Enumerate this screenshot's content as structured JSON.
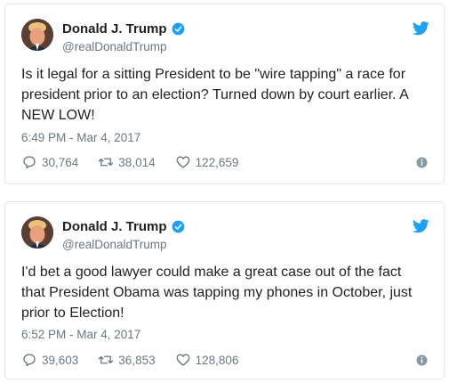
{
  "tweets": [
    {
      "name": "Donald J. Trump",
      "handle": "@realDonaldTrump",
      "text": "Is it legal for a sitting President to be \"wire tapping\" a race for president prior to an election? Turned down by court earlier. A NEW LOW!",
      "timestamp": "6:49 PM - Mar 4, 2017",
      "replies": "30,764",
      "retweets": "38,014",
      "likes": "122,659"
    },
    {
      "name": "Donald J. Trump",
      "handle": "@realDonaldTrump",
      "text": "I'd bet a good lawyer could make a great case out of the fact that President Obama was tapping my phones in October, just prior to Election!",
      "timestamp": "6:52 PM - Mar 4, 2017",
      "replies": "39,603",
      "retweets": "36,853",
      "likes": "128,806"
    }
  ],
  "icons": {
    "brand": "twitter-bird-icon",
    "verified": "verified-badge-icon",
    "reply": "reply-icon",
    "retweet": "retweet-icon",
    "like": "heart-icon",
    "info": "info-icon"
  },
  "colors": {
    "brand_blue": "#1da1f2",
    "text": "#1c2022",
    "muted": "#697882",
    "border": "#e1e8ed"
  }
}
